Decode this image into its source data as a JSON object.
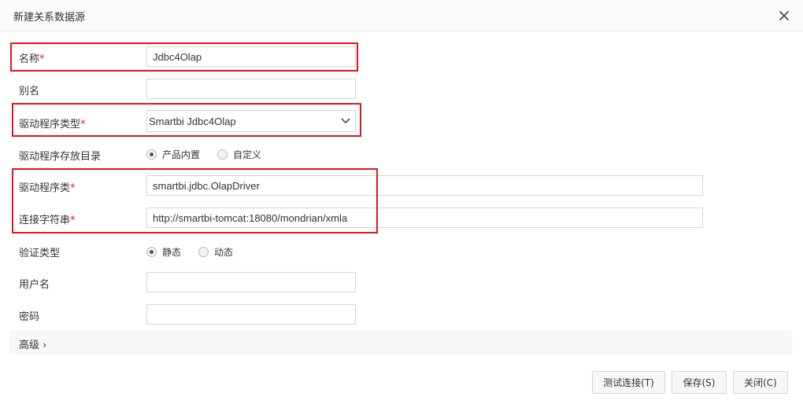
{
  "dialog": {
    "title": "新建关系数据源",
    "close_icon": "close-icon"
  },
  "fields": {
    "name": {
      "label": "名称",
      "required_mark": "*",
      "value": "Jdbc4Olap"
    },
    "alias": {
      "label": "别名",
      "value": ""
    },
    "driver_type": {
      "label": "驱动程序类型",
      "required_mark": "*",
      "selected": "Smartbi Jdbc4Olap"
    },
    "driver_location": {
      "label": "驱动程序存放目录",
      "options": [
        {
          "label": "产品内置",
          "checked": true
        },
        {
          "label": "自定义",
          "checked": false
        }
      ]
    },
    "driver_class": {
      "label": "驱动程序类",
      "required_mark": "*",
      "value": "smartbi.jdbc.OlapDriver"
    },
    "connection_string": {
      "label": "连接字符串",
      "required_mark": "*",
      "value": "http://smartbi-tomcat:18080/mondrian/xmla"
    },
    "auth_type": {
      "label": "验证类型",
      "options": [
        {
          "label": "静态",
          "checked": true
        },
        {
          "label": "动态",
          "checked": false
        }
      ]
    },
    "username": {
      "label": "用户名",
      "value": ""
    },
    "password": {
      "label": "密码",
      "value": ""
    }
  },
  "advanced": {
    "label": "高级",
    "chevron": "›"
  },
  "buttons": {
    "test": "测试连接(T)",
    "save": "保存(S)",
    "close": "关闭(C)"
  },
  "colors": {
    "highlight": "#e0141c",
    "required": "#e02020"
  }
}
